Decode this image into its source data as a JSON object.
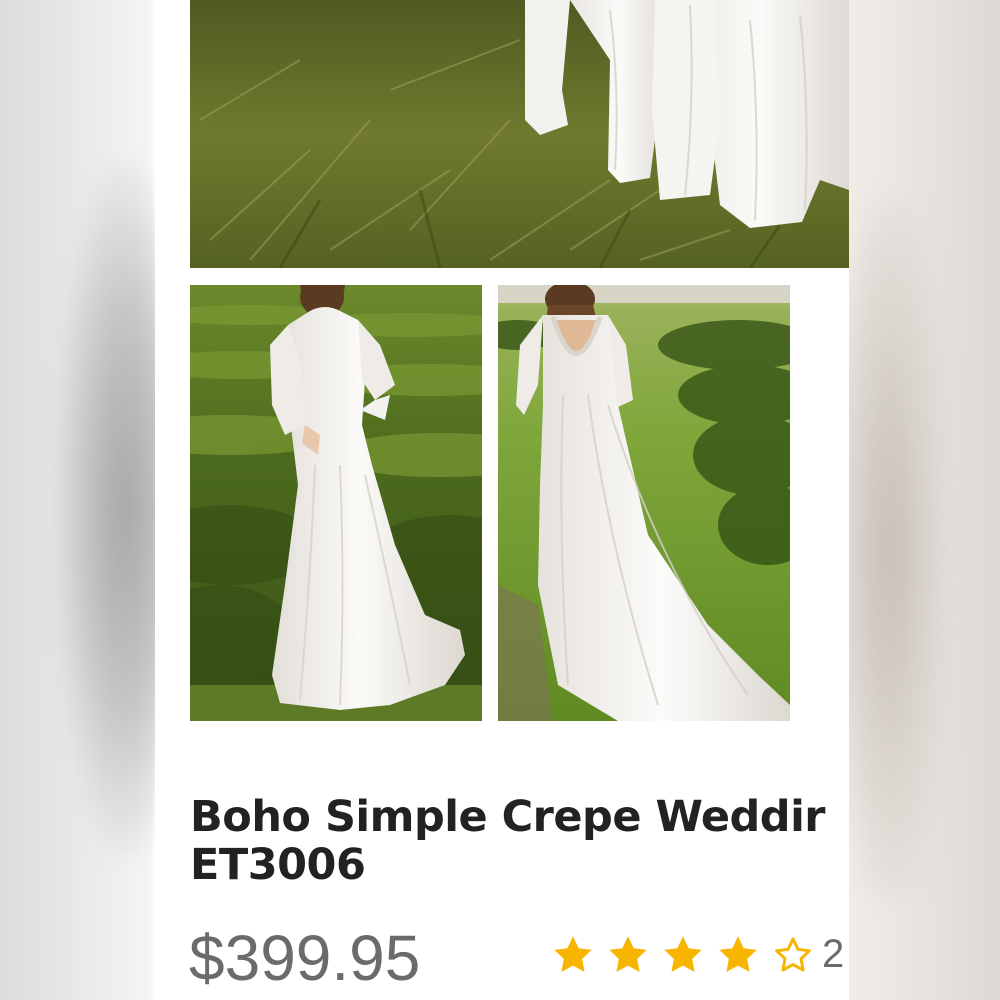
{
  "product": {
    "title_line1": "Boho Simple Crepe Weddir",
    "title_line2": "ET3006",
    "price": "$399.95",
    "rating": {
      "stars_filled": 4,
      "stars_total": 5,
      "review_count_visible": "2"
    }
  },
  "images": [
    {
      "subject": "dress-hem-on-grass"
    },
    {
      "subject": "dress-front-view"
    },
    {
      "subject": "dress-back-view"
    }
  ],
  "colors": {
    "title": "#222222",
    "price": "#6b6b6b",
    "star": "#f7b500",
    "background": "#ffffff"
  }
}
